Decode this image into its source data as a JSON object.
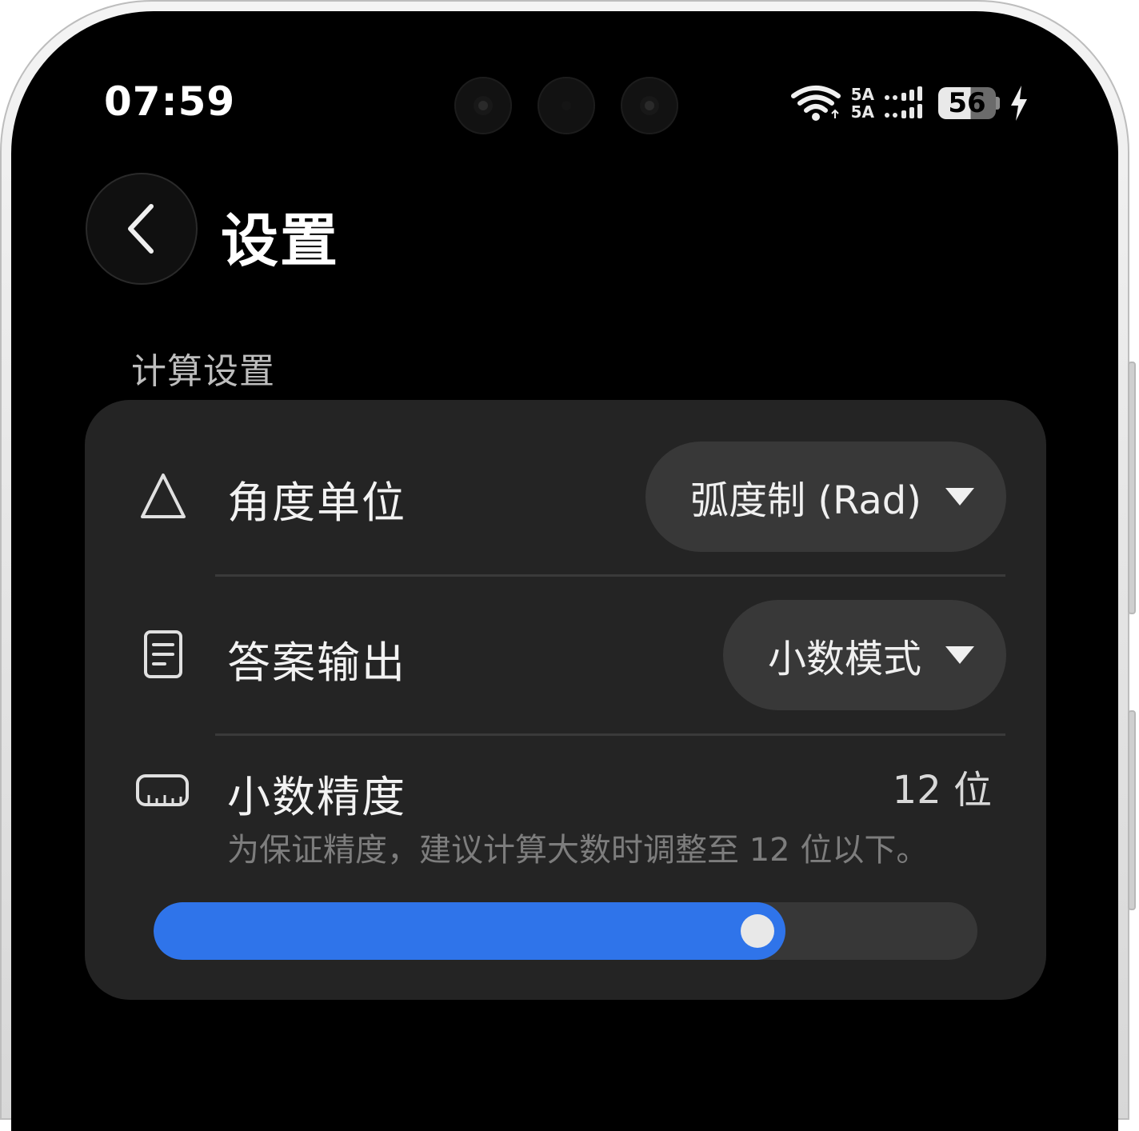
{
  "status_bar": {
    "time": "07:59",
    "network_top": "5A",
    "network_bottom": "5A",
    "battery_level": "56"
  },
  "header": {
    "title": "设置"
  },
  "section": {
    "label": "计算设置"
  },
  "settings": {
    "angle_unit": {
      "label": "角度单位",
      "value": "弧度制 (Rad)"
    },
    "answer_output": {
      "label": "答案输出",
      "value": "小数模式"
    },
    "decimal_precision": {
      "label": "小数精度",
      "value": "12 位",
      "hint": "为保证精度，建议计算大数时调整至 12 位以下。",
      "slider_fraction": 0.767
    }
  },
  "colors": {
    "accent": "#2f74ea",
    "card": "#242424",
    "background": "#000000"
  }
}
